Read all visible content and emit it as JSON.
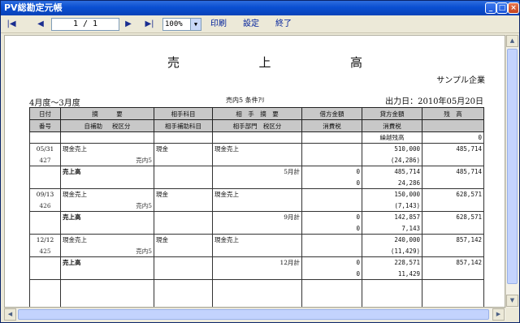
{
  "window": {
    "title": "PV総勘定元帳"
  },
  "toolbar": {
    "first": "|◀",
    "prev": "◀",
    "page": "1 / 1",
    "next": "▶",
    "last": "▶|",
    "zoom": "100%",
    "print": "印刷",
    "settings": "設定",
    "exit": "終了"
  },
  "report": {
    "title_chars": [
      "売",
      "上",
      "高"
    ],
    "company": "サンプル企業",
    "period": "4月度〜3月度",
    "condition": "売内5 条件ｱﾘ",
    "output_date": "出力日：2010年05月20日",
    "headers": {
      "date": "日付",
      "no": "番号",
      "summary": "摘　　　要",
      "sub_account": "自補助",
      "tax_class": "税区分",
      "counter_account": "相手科目",
      "counter_sub": "相手補助科目",
      "counter_summary": "相　手　摘　要",
      "counter_dept": "相手部門",
      "counter_tax": "税区分",
      "debit": "借方金額",
      "debit_tax": "消費税",
      "credit": "貸方金額",
      "credit_tax": "消費税",
      "balance": "残　高"
    },
    "carry_forward_label": "繰越残高",
    "carry_forward_value": "0",
    "entries": [
      {
        "date": "05/31",
        "no": "427",
        "summary": "現金売上",
        "tax": "売内5",
        "counter": "現金",
        "counter_summary": "現金売上",
        "credit": "510,000",
        "credit_tax": "(24,286)",
        "balance": "485,714",
        "subtotal_label": "売上高",
        "month_label": "5月計",
        "debit_sum": "0",
        "debit_tax_sum": "0",
        "credit_sum": "485,714",
        "credit_tax_sum": "24,286",
        "sub_balance": "485,714"
      },
      {
        "date": "09/13",
        "no": "426",
        "summary": "現金売上",
        "tax": "売内5",
        "counter": "現金",
        "counter_summary": "現金売上",
        "credit": "150,000",
        "credit_tax": "(7,143)",
        "balance": "628,571",
        "subtotal_label": "売上高",
        "month_label": "9月計",
        "debit_sum": "0",
        "debit_tax_sum": "0",
        "credit_sum": "142,857",
        "credit_tax_sum": "7,143",
        "sub_balance": "628,571"
      },
      {
        "date": "12/12",
        "no": "425",
        "summary": "現金売上",
        "tax": "売内5",
        "counter": "現金",
        "counter_summary": "現金売上",
        "credit": "240,000",
        "credit_tax": "(11,429)",
        "balance": "857,142",
        "subtotal_label": "売上高",
        "month_label": "12月計",
        "debit_sum": "0",
        "debit_tax_sum": "0",
        "credit_sum": "228,571",
        "credit_tax_sum": "11,429",
        "sub_balance": "857,142"
      }
    ]
  }
}
